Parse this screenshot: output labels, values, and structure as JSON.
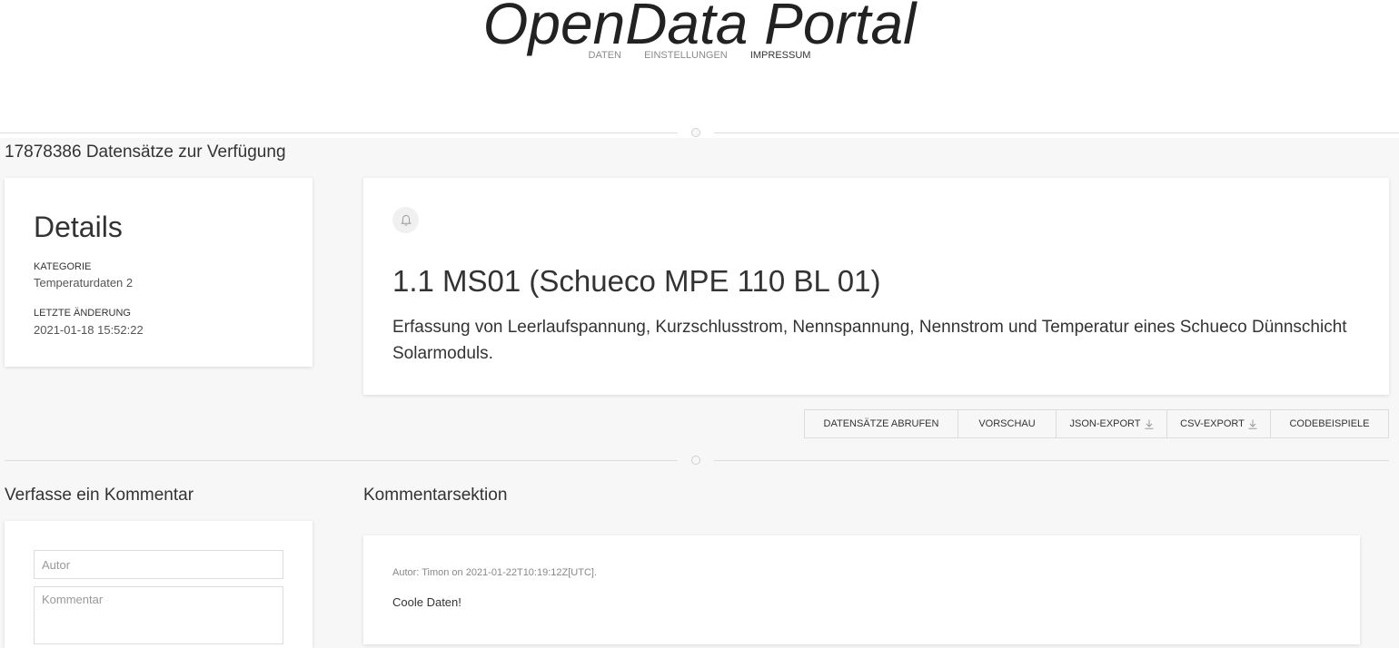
{
  "header": {
    "logo": "OpenData Portal",
    "nav": [
      {
        "label": "DATEN",
        "active": false
      },
      {
        "label": "EINSTELLUNGEN",
        "active": false
      },
      {
        "label": "IMPRESSUM",
        "active": true
      }
    ]
  },
  "summary": {
    "count_text": "17878386 Datensätze zur Verfügung"
  },
  "details": {
    "title": "Details",
    "category_label": "KATEGORIE",
    "category_value": "Temperaturdaten 2",
    "changed_label": "LETZTE ÄNDERUNG",
    "changed_value": "2021-01-18 15:52:22"
  },
  "dataset": {
    "icon": "bell-icon",
    "title": "1.1 MS01 (Schueco MPE 110 BL 01)",
    "description": "Erfassung von Leerlaufspannung, Kurzschlusstrom, Nennspannung, Nennstrom und Temperatur eines Schueco Dünnschicht Solarmoduls."
  },
  "actions": {
    "fetch": "DATENSÄTZE ABRUFEN",
    "preview": "VORSCHAU",
    "json_export": "JSON-EXPORT",
    "csv_export": "CSV-EXPORT",
    "code_examples": "CODEBEISPIELE"
  },
  "comment_form": {
    "title": "Verfasse ein Kommentar",
    "author_placeholder": "Autor",
    "comment_placeholder": "Kommentar"
  },
  "comments": {
    "title": "Kommentarsektion",
    "items": [
      {
        "meta": "Autor: Timon on 2021-01-22T10:19:12Z[UTC].",
        "text": "Coole Daten!"
      }
    ]
  },
  "colors": {
    "background": "#f7f7f7",
    "card": "#ffffff",
    "text": "#333333",
    "muted": "#8a8a8a"
  }
}
